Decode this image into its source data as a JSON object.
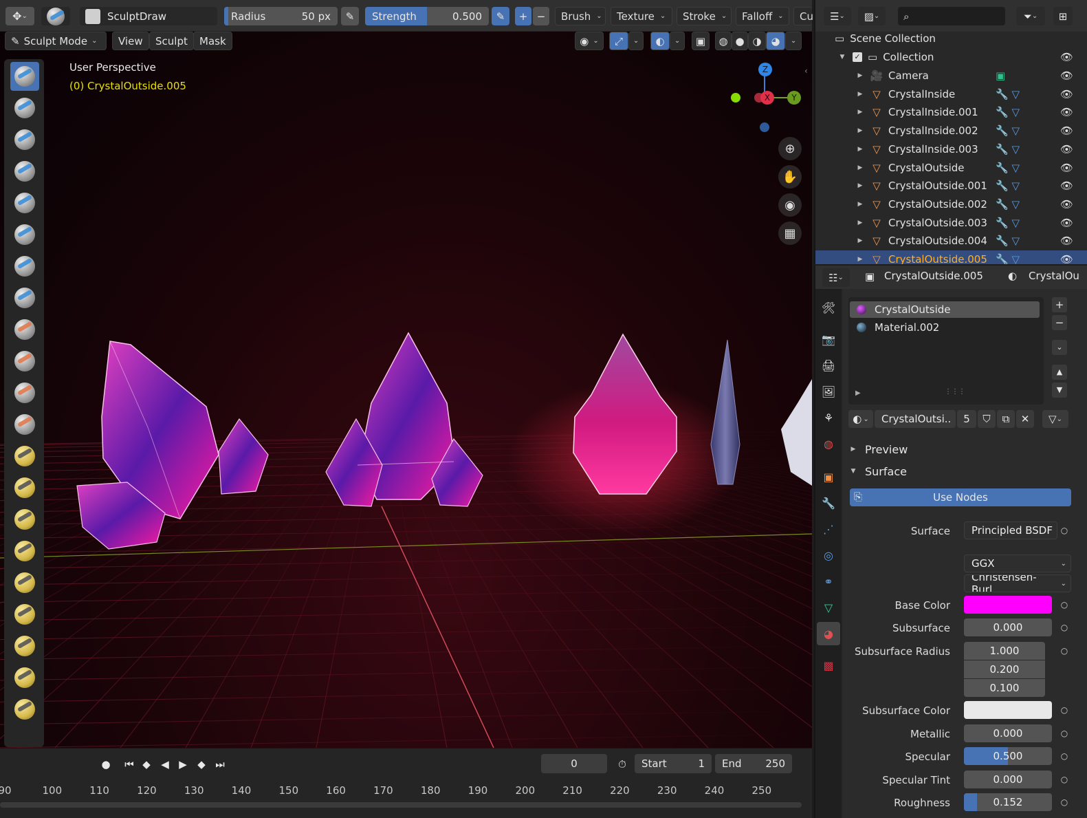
{
  "header": {
    "brush_name": "SculptDraw",
    "radius_label": "Radius",
    "radius_value": "50 px",
    "strength_label": "Strength",
    "strength_value": "0.500",
    "strength_fraction": 0.5,
    "menus": [
      "Brush",
      "Texture",
      "Stroke",
      "Falloff",
      "Cu"
    ]
  },
  "modebar": {
    "mode": "Sculpt Mode",
    "menus": [
      "View",
      "Sculpt",
      "Mask"
    ]
  },
  "viewport": {
    "perspective_label": "User Perspective",
    "object_label": "(0) CrystalOutside.005",
    "gizmo": {
      "z": "Z",
      "x": "X",
      "y": "Y"
    }
  },
  "timeline": {
    "current_frame": "0",
    "start_label": "Start",
    "start_value": "1",
    "end_label": "End",
    "end_value": "250",
    "ruler": [
      "90",
      "100",
      "110",
      "120",
      "130",
      "140",
      "150",
      "160",
      "170",
      "180",
      "190",
      "200",
      "210",
      "220",
      "230",
      "240",
      "250"
    ]
  },
  "outliner": {
    "scene_collection": "Scene Collection",
    "collection": "Collection",
    "items": [
      {
        "name": "Camera",
        "type": "camera"
      },
      {
        "name": "CrystalInside",
        "type": "mesh"
      },
      {
        "name": "CrystalInside.001",
        "type": "mesh"
      },
      {
        "name": "CrystalInside.002",
        "type": "mesh"
      },
      {
        "name": "CrystalInside.003",
        "type": "mesh"
      },
      {
        "name": "CrystalOutside",
        "type": "mesh"
      },
      {
        "name": "CrystalOutside.001",
        "type": "mesh"
      },
      {
        "name": "CrystalOutside.002",
        "type": "mesh"
      },
      {
        "name": "CrystalOutside.003",
        "type": "mesh"
      },
      {
        "name": "CrystalOutside.004",
        "type": "mesh"
      },
      {
        "name": "CrystalOutside.005",
        "type": "mesh",
        "selected": true
      }
    ]
  },
  "properties": {
    "object_name": "CrystalOutside.005",
    "material_tab_name": "CrystalOu",
    "slots": [
      "CrystalOutside",
      "Material.002"
    ],
    "material_name": "CrystalOutsi..",
    "users": "5",
    "panel_preview": "Preview",
    "panel_surface": "Surface",
    "use_nodes": "Use Nodes",
    "surface_label": "Surface",
    "surface_value": "Principled BSDF",
    "distribution": "GGX",
    "subsurface_method": "Christensen-Burl..",
    "base_color_label": "Base Color",
    "base_color": "#ff00ff",
    "subsurface_label": "Subsurface",
    "subsurface_value": "0.000",
    "subsurface_radius_label": "Subsurface Radius",
    "subsurface_radius": [
      "1.000",
      "0.200",
      "0.100"
    ],
    "subsurface_color_label": "Subsurface Color",
    "subsurface_color": "#e8e8e8",
    "metallic_label": "Metallic",
    "metallic_value": "0.000",
    "specular_label": "Specular",
    "specular_value": "0.500",
    "specular_fraction": 0.5,
    "specular_tint_label": "Specular Tint",
    "specular_tint_value": "0.000",
    "roughness_label": "Roughness",
    "roughness_value": "0.152",
    "roughness_fraction": 0.152
  },
  "colors": {
    "accent": "#4772b3",
    "selected_text": "#ffaf29",
    "object_label": "#e8e000"
  }
}
